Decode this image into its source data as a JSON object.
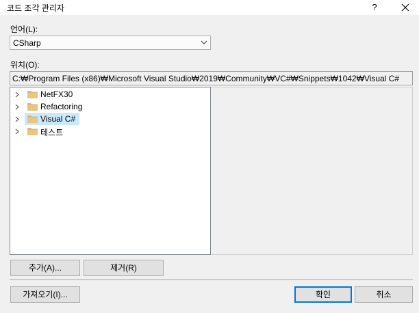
{
  "window": {
    "title": "코드 조각 관리자",
    "help_label": "?"
  },
  "language": {
    "label": "언어(L):",
    "selected": "CSharp"
  },
  "location": {
    "label": "위치(O):",
    "path": "C:₩Program Files (x86)₩Microsoft Visual Studio₩2019₩Community₩VC#₩Snippets₩1042₩Visual C#"
  },
  "tree": {
    "items": [
      {
        "label": "NetFX30"
      },
      {
        "label": "Refactoring"
      },
      {
        "label": "Visual C#",
        "selected": true
      },
      {
        "label": "테스트"
      }
    ]
  },
  "buttons": {
    "add": "추가(A)...",
    "remove": "제거(R)",
    "import": "가져오기(I)...",
    "ok": "확인",
    "cancel": "취소"
  },
  "colors": {
    "folder": "#dcb67a",
    "selection": "#cce8ff",
    "accent": "#0078d7"
  },
  "icons": {
    "folder": "folder-icon",
    "expand": "chevron-right-icon",
    "dropdown": "chevron-down-icon",
    "close": "close-icon"
  }
}
